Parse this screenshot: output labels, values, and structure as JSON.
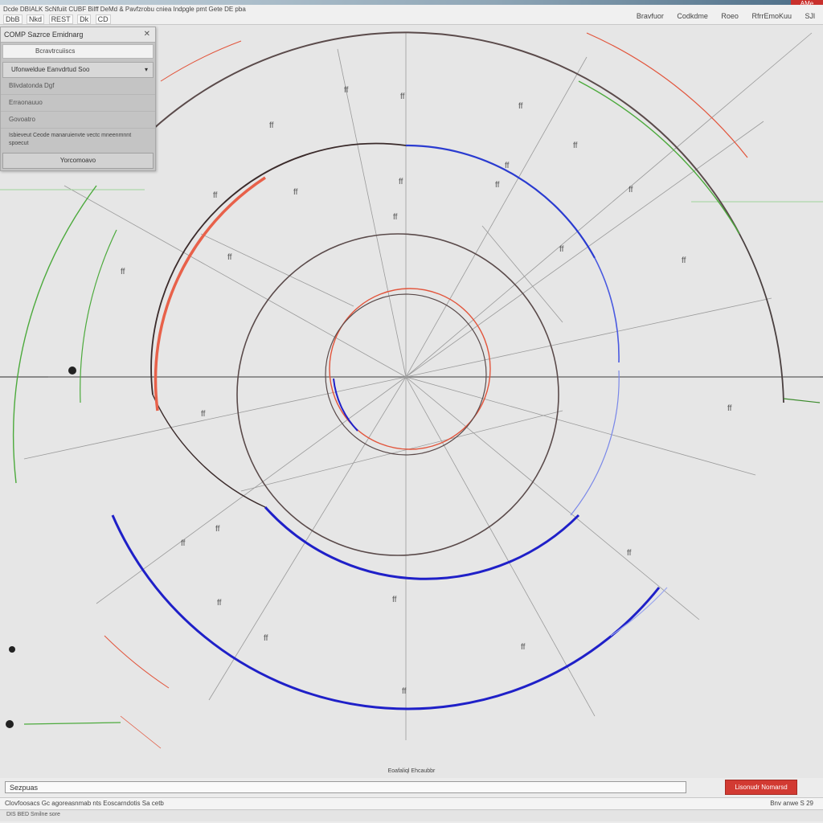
{
  "window": {
    "menu_text": "Dcde  DBIALK  ScNfuiit  CUBF  Bilff DeMd & Pavfzrobu cniea Indpgle pmt Gete DE pba",
    "toolbar_items": [
      "DbB",
      "Nkd",
      "REST",
      "Dk",
      "CD"
    ],
    "right_info": [
      "Bravfuor",
      "Codkdme",
      "Roeo",
      "RfrrEmoKuu",
      "SJl"
    ],
    "corner_badge": "AMe"
  },
  "panel": {
    "title": "COMP  Sazrce Emidnarg",
    "close_icon": "close-icon",
    "field_value": "Bcravtrcuiiscs",
    "dropdown_value": "Ufonweldue  Eanvdrtud Soo",
    "row1": "Blivdatonda  Dgf",
    "row2": "Erraonauuo",
    "section_label": "Govoatro",
    "description": "Isbieveut Ceode manaruienvte vectc mneenmnnt spoecut",
    "button_label": "Yorcomoavo"
  },
  "bottom": {
    "center_label": "Eoafaliql  Ehcaubbr",
    "cmd_label": "Sezpuas",
    "cmd_placeholder": "",
    "run_button": "Lisonudr  Nomarsd",
    "status_left": "Clovfoosacs   Gc agoreasnmab   nts   Eoscarndotis  Sa  cetb",
    "status_right": "Bnv anwe  S  29",
    "status_left2": "DIS  BED  Smilne sore"
  },
  "colors": {
    "grid": "#9a9a9a",
    "circle_dark": "#5a4a4a",
    "circle_blue": "#1f20c8",
    "circle_red": "#e2553c",
    "circle_green": "#4caa3c",
    "run_button": "#d23a32"
  },
  "canvas_labels": [
    "ff",
    "ff",
    "ff",
    "ff",
    "ff",
    "ff",
    "ff",
    "ff",
    "ff",
    "ff",
    "ff",
    "ff",
    "ff",
    "ff",
    "ff",
    "ff",
    "ff",
    "ff",
    "ff",
    "ff",
    "ff",
    "ff",
    "ff",
    "ff",
    "ff",
    "ff"
  ]
}
